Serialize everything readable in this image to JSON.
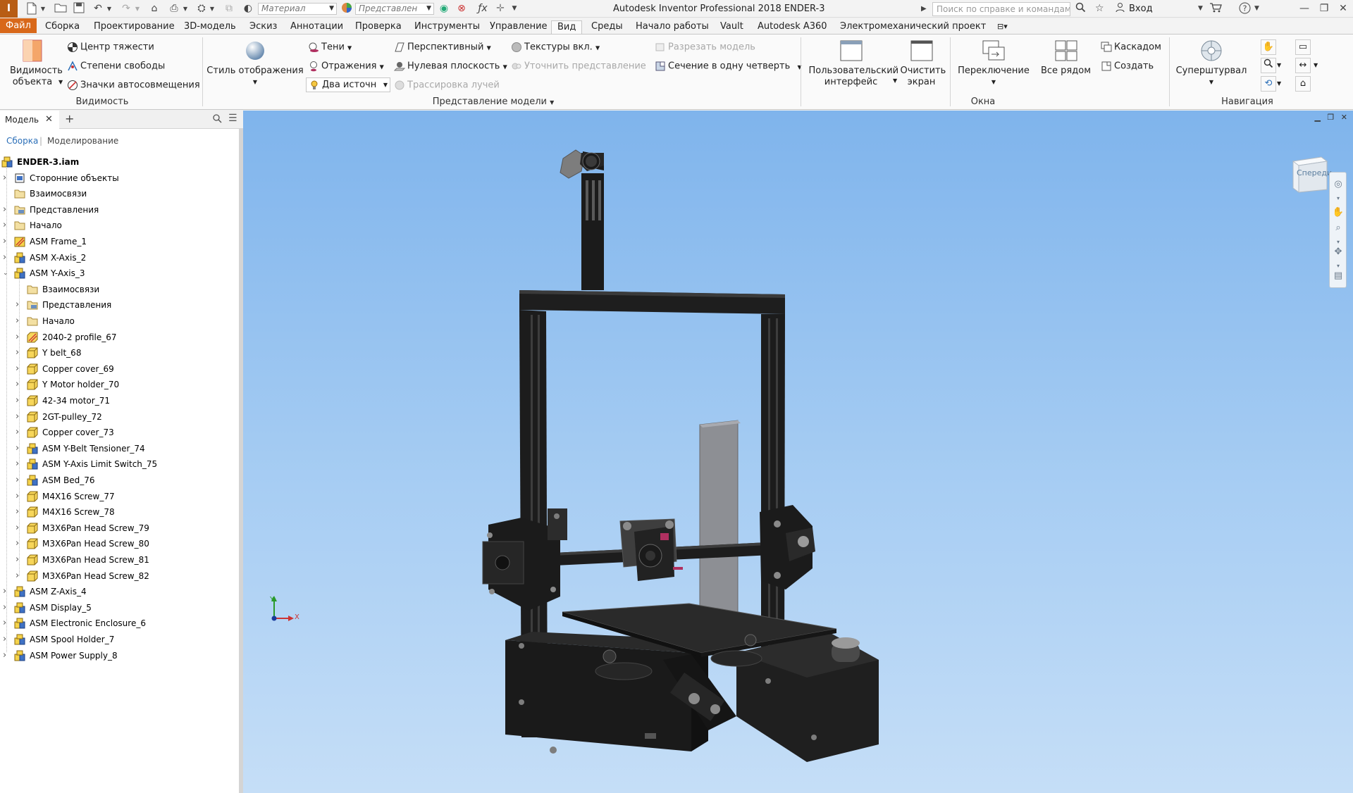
{
  "app": {
    "logo": "I",
    "title": "Autodesk Inventor Professional 2018    ENDER-3",
    "material_placeholder": "Материал",
    "representation_placeholder": "Представлен",
    "help_search_placeholder": "Поиск по справке и командам",
    "login_label": "Вход"
  },
  "tabs": [
    "Файл",
    "Сборка",
    "Проектирование",
    "3D-модель",
    "Эскиз",
    "Аннотации",
    "Проверка",
    "Инструменты",
    "Управление",
    "Вид",
    "Среды",
    "Начало работы",
    "Vault",
    "Autodesk A360",
    "Электромеханический проект"
  ],
  "active_tab": "Вид",
  "ribbon": {
    "visibility": {
      "object_visibility": "Видимость объекта",
      "center_of_gravity": "Центр тяжести",
      "degrees_of_freedom": "Степени свободы",
      "autolimit_icons": "Значки автосовмещения",
      "group_label": "Видимость"
    },
    "appearance": {
      "visual_style": "Стиль отображения",
      "shadows": "Тени",
      "reflections": "Отражения",
      "two_lights": "Два источн",
      "perspective": "Перспективный",
      "ground_plane": "Нулевая плоскость",
      "ray_tracing": "Трассировка лучей",
      "textures_on": "Текстуры вкл.",
      "refine_representation": "Уточнить представление",
      "slice_model": "Разрезать модель",
      "quarter_section": "Сечение в одну четверть",
      "group_label": "Представление модели"
    },
    "windows": {
      "user_interface": "Пользовательский интерфейс",
      "clean_screen": "Очистить экран",
      "switch": "Переключение",
      "tile": "Все рядом",
      "cascade": "Каскадом",
      "new_window": "Создать",
      "group_label": "Окна"
    },
    "navigation": {
      "steering_wheels": "Суперштурвал",
      "group_label": "Навигация"
    }
  },
  "browser": {
    "tab_label": "Модель",
    "mode_assembly": "Сборка",
    "mode_modeling": "Моделирование",
    "tree": [
      {
        "label": "ENDER-3.iam",
        "level": 0,
        "icon": "assembly-icon",
        "expander": "none",
        "bold": true
      },
      {
        "label": "Сторонние объекты",
        "level": 1,
        "icon": "third-party-icon",
        "expander": "collapsed"
      },
      {
        "label": "Взаимосвязи",
        "level": 1,
        "icon": "folder-icon",
        "expander": "none"
      },
      {
        "label": "Представления",
        "level": 1,
        "icon": "representations-folder-icon",
        "expander": "collapsed"
      },
      {
        "label": "Начало",
        "level": 1,
        "icon": "folder-icon",
        "expander": "collapsed"
      },
      {
        "label": "ASM Frame_1",
        "level": 1,
        "icon": "frame-assembly-icon",
        "expander": "collapsed"
      },
      {
        "label": "ASM X-Axis_2",
        "level": 1,
        "icon": "assembly-icon",
        "expander": "collapsed"
      },
      {
        "label": "ASM Y-Axis_3",
        "level": 1,
        "icon": "assembly-icon",
        "expander": "expanded"
      },
      {
        "label": "Взаимосвязи",
        "level": 2,
        "icon": "folder-icon",
        "expander": "none"
      },
      {
        "label": "Представления",
        "level": 2,
        "icon": "representations-folder-icon",
        "expander": "collapsed"
      },
      {
        "label": "Начало",
        "level": 2,
        "icon": "folder-icon",
        "expander": "collapsed"
      },
      {
        "label": "2040-2 profile_67",
        "level": 2,
        "icon": "frame-part-icon",
        "expander": "collapsed"
      },
      {
        "label": "Y belt_68",
        "level": 2,
        "icon": "part-icon",
        "expander": "collapsed"
      },
      {
        "label": "Copper cover_69",
        "level": 2,
        "icon": "part-icon",
        "expander": "collapsed"
      },
      {
        "label": "Y Motor holder_70",
        "level": 2,
        "icon": "part-icon",
        "expander": "collapsed"
      },
      {
        "label": "42-34 motor_71",
        "level": 2,
        "icon": "part-icon",
        "expander": "collapsed"
      },
      {
        "label": "2GT-pulley_72",
        "level": 2,
        "icon": "part-icon",
        "expander": "collapsed"
      },
      {
        "label": "Copper cover_73",
        "level": 2,
        "icon": "part-icon",
        "expander": "collapsed"
      },
      {
        "label": "ASM Y-Belt Tensioner_74",
        "level": 2,
        "icon": "assembly-icon",
        "expander": "collapsed"
      },
      {
        "label": "ASM Y-Axis Limit Switch_75",
        "level": 2,
        "icon": "assembly-icon",
        "expander": "collapsed"
      },
      {
        "label": "ASM Bed_76",
        "level": 2,
        "icon": "assembly-icon",
        "expander": "collapsed"
      },
      {
        "label": "M4X16 Screw_77",
        "level": 2,
        "icon": "part-icon",
        "expander": "collapsed"
      },
      {
        "label": "M4X16 Screw_78",
        "level": 2,
        "icon": "part-icon",
        "expander": "collapsed"
      },
      {
        "label": "M3X6Pan Head Screw_79",
        "level": 2,
        "icon": "part-icon",
        "expander": "collapsed"
      },
      {
        "label": "M3X6Pan Head Screw_80",
        "level": 2,
        "icon": "part-icon",
        "expander": "collapsed"
      },
      {
        "label": "M3X6Pan Head Screw_81",
        "level": 2,
        "icon": "part-icon",
        "expander": "collapsed"
      },
      {
        "label": "M3X6Pan Head Screw_82",
        "level": 2,
        "icon": "part-icon",
        "expander": "collapsed"
      },
      {
        "label": "ASM Z-Axis_4",
        "level": 1,
        "icon": "assembly-icon",
        "expander": "collapsed"
      },
      {
        "label": "ASM Display_5",
        "level": 1,
        "icon": "assembly-icon",
        "expander": "collapsed"
      },
      {
        "label": "ASM Electronic Enclosure_6",
        "level": 1,
        "icon": "assembly-icon",
        "expander": "collapsed"
      },
      {
        "label": "ASM Spool Holder_7",
        "level": 1,
        "icon": "assembly-icon",
        "expander": "collapsed"
      },
      {
        "label": "ASM Power Supply_8",
        "level": 1,
        "icon": "assembly-icon",
        "expander": "collapsed"
      }
    ]
  },
  "viewport": {
    "viewcube_label": "Спереди",
    "axis_x": "X",
    "axis_y": "Y"
  },
  "colors": {
    "file_tab": "#d8681a",
    "accent_blue": "#2b6fb8",
    "viewport_top": "#7fb4ec",
    "viewport_bottom": "#c5def7"
  }
}
